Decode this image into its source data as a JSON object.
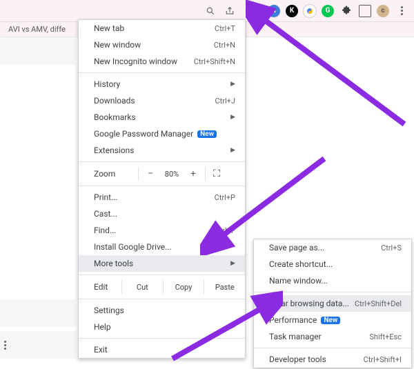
{
  "colors": {
    "arrow": "#8a2be2",
    "badge_bg": "#1a73e8"
  },
  "tab": {
    "title": "AVI vs AMV, diffe"
  },
  "toolbar_icons": [
    "magnify",
    "share",
    "refresh",
    "a",
    "k",
    "s",
    "g",
    "puzzle",
    "square",
    "c",
    "menu"
  ],
  "main_menu": {
    "new_tab": {
      "label": "New tab",
      "shortcut": "Ctrl+T"
    },
    "new_window": {
      "label": "New window",
      "shortcut": "Ctrl+N"
    },
    "new_incognito": {
      "label": "New Incognito window",
      "shortcut": "Ctrl+Shift+N"
    },
    "history": {
      "label": "History"
    },
    "downloads": {
      "label": "Downloads",
      "shortcut": "Ctrl+J"
    },
    "bookmarks": {
      "label": "Bookmarks"
    },
    "password_mgr": {
      "label": "Google Password Manager",
      "badge": "New"
    },
    "extensions": {
      "label": "Extensions"
    },
    "zoom": {
      "label": "Zoom",
      "minus": "−",
      "value": "80%",
      "plus": "+"
    },
    "print": {
      "label": "Print...",
      "shortcut": "Ctrl+P"
    },
    "cast": {
      "label": "Cast..."
    },
    "find": {
      "label": "Find...",
      "shortcut": "Ctrl+F"
    },
    "install_drive": {
      "label": "Install Google Drive..."
    },
    "more_tools": {
      "label": "More tools"
    },
    "edit": {
      "label": "Edit",
      "cut": "Cut",
      "copy": "Copy",
      "paste": "Paste"
    },
    "settings": {
      "label": "Settings"
    },
    "help": {
      "label": "Help"
    },
    "exit": {
      "label": "Exit"
    }
  },
  "sub_menu": {
    "save_page": {
      "label": "Save page as...",
      "shortcut": "Ctrl+S"
    },
    "create_shortcut": {
      "label": "Create shortcut..."
    },
    "name_window": {
      "label": "Name window..."
    },
    "clear_data": {
      "label": "Clear browsing data...",
      "shortcut": "Ctrl+Shift+Del"
    },
    "performance": {
      "label": "Performance",
      "badge": "New"
    },
    "task_manager": {
      "label": "Task manager",
      "shortcut": "Shift+Esc"
    },
    "dev_tools": {
      "label": "Developer tools",
      "shortcut": "Ctrl+Shift+I"
    }
  }
}
